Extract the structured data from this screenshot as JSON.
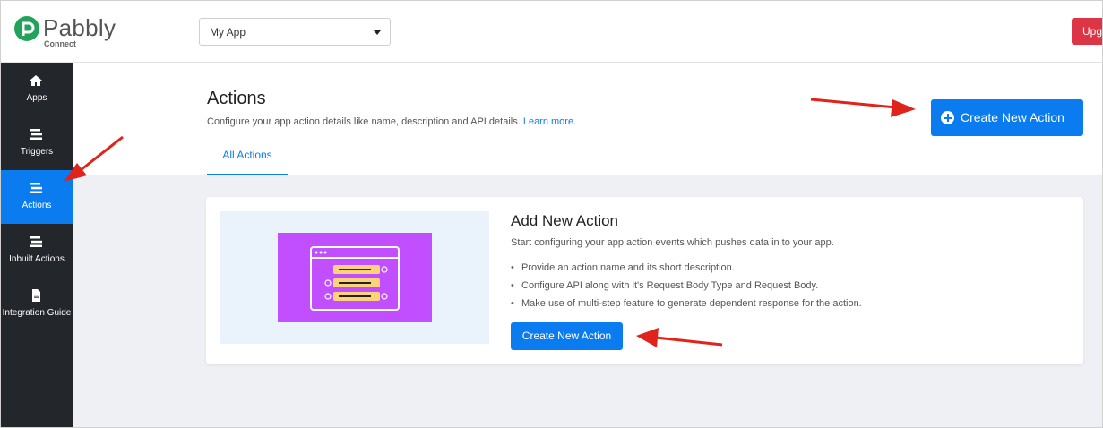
{
  "brand": {
    "name": "Pabbly",
    "sub": "Connect"
  },
  "header": {
    "app_select": {
      "value": "My App"
    },
    "upgrade_label": "Upg"
  },
  "sidebar": {
    "items": [
      {
        "label": "Apps",
        "icon": "home-icon",
        "active": false
      },
      {
        "label": "Triggers",
        "icon": "list-icon",
        "active": false
      },
      {
        "label": "Actions",
        "icon": "list-icon",
        "active": true
      },
      {
        "label": "Inbuilt Actions",
        "icon": "list-icon",
        "active": false
      },
      {
        "label": "Integration Guide",
        "icon": "document-icon",
        "active": false
      }
    ]
  },
  "page": {
    "title": "Actions",
    "subtitle": "Configure your app action details like name, description and API details.",
    "learn_more": "Learn more.",
    "tabs": [
      {
        "label": "All Actions",
        "active": true
      }
    ],
    "create_button": "Create New Action"
  },
  "card": {
    "title": "Add New Action",
    "description": "Start configuring your app action events which pushes data in to your app.",
    "bullets": [
      "Provide an action name and its short description.",
      "Configure API along with it's Request Body Type and Request Body.",
      "Make use of multi-step feature to generate dependent response for the action."
    ],
    "button": "Create New Action"
  },
  "colors": {
    "primary": "#0a7cf0",
    "sidebar_bg": "#23262b",
    "danger": "#dc3545",
    "illustration": "#c14eff",
    "annotation_arrow": "#e0241c"
  }
}
